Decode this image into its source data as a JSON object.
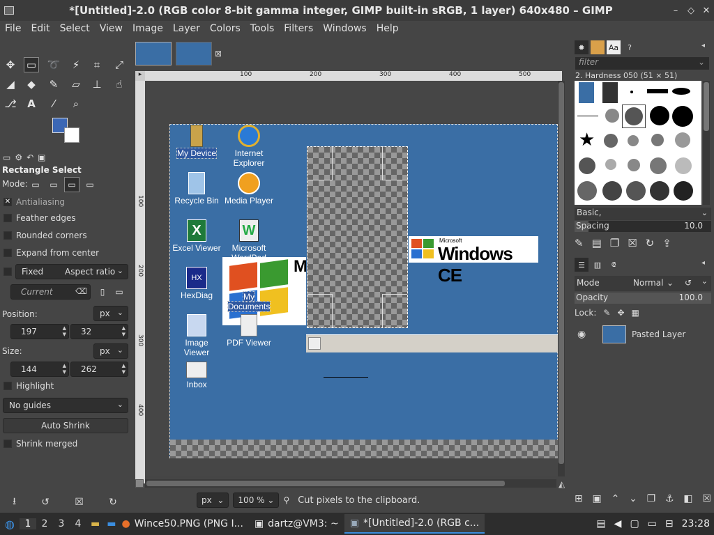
{
  "window": {
    "title": "*[Untitled]-2.0 (RGB color 8-bit gamma integer, GIMP built-in sRGB, 1 layer) 640x480 – GIMP",
    "minimize": "–",
    "restore": "◇",
    "close": "✕"
  },
  "menu": [
    "File",
    "Edit",
    "Select",
    "View",
    "Image",
    "Layer",
    "Colors",
    "Tools",
    "Filters",
    "Windows",
    "Help"
  ],
  "tool_options": {
    "title": "Rectangle Select",
    "mode_label": "Mode:",
    "antialiasing": "Antialiasing",
    "feather": "Feather edges",
    "rounded": "Rounded corners",
    "expand": "Expand from center",
    "fixed": "Fixed",
    "aspect": "Aspect ratio",
    "current_placeholder": "Current",
    "position_label": "Position:",
    "position_unit": "px",
    "pos_x": "197",
    "pos_y": "32",
    "size_label": "Size:",
    "size_unit": "px",
    "size_w": "144",
    "size_h": "262",
    "highlight": "Highlight",
    "guides": "No guides",
    "auto_shrink": "Auto Shrink",
    "shrink_merged": "Shrink merged"
  },
  "rulers": {
    "h": [
      "100",
      "200",
      "300",
      "400",
      "500"
    ],
    "v": [
      "100",
      "200",
      "300",
      "400"
    ]
  },
  "desktop_icons": [
    {
      "label1": "My Device",
      "label2": ""
    },
    {
      "label1": "Internet",
      "label2": "Explorer"
    },
    {
      "label1": "Recycle Bin",
      "label2": ""
    },
    {
      "label1": "Media Player",
      "label2": ""
    },
    {
      "label1": "Excel Viewer",
      "label2": ""
    },
    {
      "label1": "Microsoft",
      "label2": "WordPad"
    },
    {
      "label1": "HexDiag",
      "label2": ""
    },
    {
      "label1": "My",
      "label2": "Documents"
    },
    {
      "label1": "Image",
      "label2": "Viewer"
    },
    {
      "label1": "PDF Viewer",
      "label2": ""
    },
    {
      "label1": "Inbox",
      "label2": ""
    }
  ],
  "logo": {
    "ms": "Microsoft",
    "brand": "Windows CE",
    "xp_letter": "M"
  },
  "brushes": {
    "filter_placeholder": "filter",
    "current": "2. Hardness 050 (51 × 51)",
    "preset": "Basic,",
    "spacing_label": "Spacing",
    "spacing_value": "10.0"
  },
  "layers": {
    "mode_label": "Mode",
    "mode_value": "Normal",
    "opacity_label": "Opacity",
    "opacity_value": "100.0",
    "lock_label": "Lock:",
    "layer_name": "Pasted Layer"
  },
  "status": {
    "unit": "px",
    "zoom": "100 %",
    "message": "Cut pixels to the clipboard."
  },
  "taskbar": {
    "workspaces": [
      "1",
      "2",
      "3",
      "4"
    ],
    "apps": [
      {
        "label": "Wince50.PNG (PNG I..."
      },
      {
        "label": "dartz@VM3: ~"
      },
      {
        "label": "*[Untitled]-2.0 (RGB c..."
      }
    ],
    "clock": "23:28"
  },
  "colors": {
    "accent": "#3b67b5",
    "desktop": "#3a6ea5"
  }
}
